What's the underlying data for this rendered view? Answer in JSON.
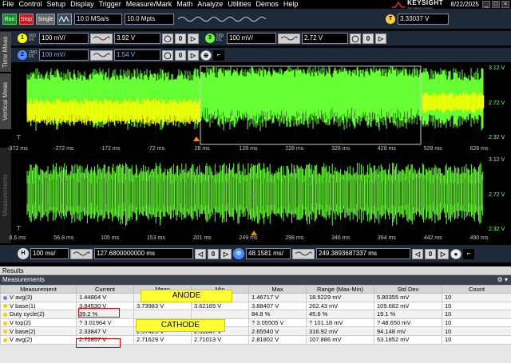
{
  "menu": [
    "File",
    "Control",
    "Setup",
    "Display",
    "Trigger",
    "Measure/Mark",
    "Math",
    "Analyze",
    "Utilities",
    "Demos",
    "Help"
  ],
  "brand": {
    "name": "KEYSIGHT",
    "sub": "TECHNOLOGIES"
  },
  "date": "8/22/2025",
  "toolbar": {
    "run": "Run",
    "stop": "Stop",
    "single": "Single",
    "sample_rate": "10.0 MSa/s",
    "memory": "10.0 Mpts",
    "trigger_level": "3.33037 V",
    "trigger_badge": "T"
  },
  "channels": [
    {
      "num": "1",
      "coupling_top": "50Ω",
      "coupling_bot": "DC",
      "scale": "100 mV/",
      "offset": "3.92 V",
      "color": "#ffff00"
    },
    {
      "num": "2",
      "coupling_top": "1MΩ",
      "coupling_bot": "DC",
      "scale": "100 mV/",
      "offset": "1.54 V",
      "color": "#4f8bff"
    },
    {
      "num": "3",
      "coupling_top": "50Ω",
      "coupling_bot": "DC",
      "scale": "100 mV/",
      "offset": "2.72 V",
      "color": "#66ff33"
    }
  ],
  "side_tabs": {
    "time_meas": "Time Meas",
    "vertical_meas": "Vertical Meas",
    "measurements": "Measurements"
  },
  "upper_xlabels": [
    "-372 ms",
    "-272 ms",
    "-172 ms",
    "-72 ms",
    "28 ms",
    "128 ms",
    "228 ms",
    "328 ms",
    "428 ms",
    "528 ms",
    "628 ms"
  ],
  "lower_xlabels": [
    "8.6 ms",
    "56.8 ms",
    "105 ms",
    "153 ms",
    "201 ms",
    "249 ms",
    "298 ms",
    "346 ms",
    "394 ms",
    "442 ms",
    "490 ms"
  ],
  "right_scale": [
    "3.12 V",
    "2.72 V",
    "2.32 V",
    "3.12 V",
    "2.72 V",
    "2.32 V"
  ],
  "horizontal": {
    "scale": "100 ms/",
    "position": "127.6800000000 ms",
    "zoom_scale": "48.1581 ms/",
    "zoom_position": "249.3893687337 ms"
  },
  "results": {
    "title": "Results",
    "panel": "Measurements"
  },
  "table": {
    "headers": [
      "Measurement",
      "Current",
      "Mean",
      "Min",
      "Max",
      "Range (Max-Min)",
      "Std Dev",
      "Count"
    ],
    "rows": [
      {
        "color": "#4f8bff",
        "cells": [
          "V avg(3)",
          "1.44864 V",
          "",
          "",
          "1.46717 V",
          "18.5229 mV",
          "5.80355 mV",
          "10"
        ]
      },
      {
        "color": "#ffcc00",
        "cells": [
          "V base(1)",
          "3.84530 V",
          "3.73983 V",
          "3.62165 V",
          "3.88407 V",
          "262.43 mV",
          "109.682 mV",
          "10"
        ]
      },
      {
        "color": "#ffcc00",
        "cells": [
          "Duty cycle(2)",
          "39.2 %",
          "",
          "",
          "84.8 %",
          "45.6 %",
          "19.1 %",
          "10"
        ]
      },
      {
        "color": "#ffcc00",
        "cells": [
          "V top(2)",
          "? 3.01964 V",
          "",
          "",
          "? 3.05505 V",
          "? 101.18 mV",
          "? 48.650 mV",
          "10"
        ]
      },
      {
        "color": "#ffcc00",
        "cells": [
          "V base(2)",
          "2.33847 V",
          "2.57429 V",
          "2.33847 V",
          "2.65540 V",
          "316.92 mV",
          "94.148 mV",
          "10"
        ]
      },
      {
        "color": "#ffcc00",
        "cells": [
          "V avg(2)",
          "2.72857 V",
          "2.71629 V",
          "2.71013 V",
          "2.81802 V",
          "107.886 mV",
          "53.1852 mV",
          "10"
        ]
      }
    ]
  },
  "annotations": {
    "anode": "ANODE",
    "cathode": "CATHODE"
  }
}
